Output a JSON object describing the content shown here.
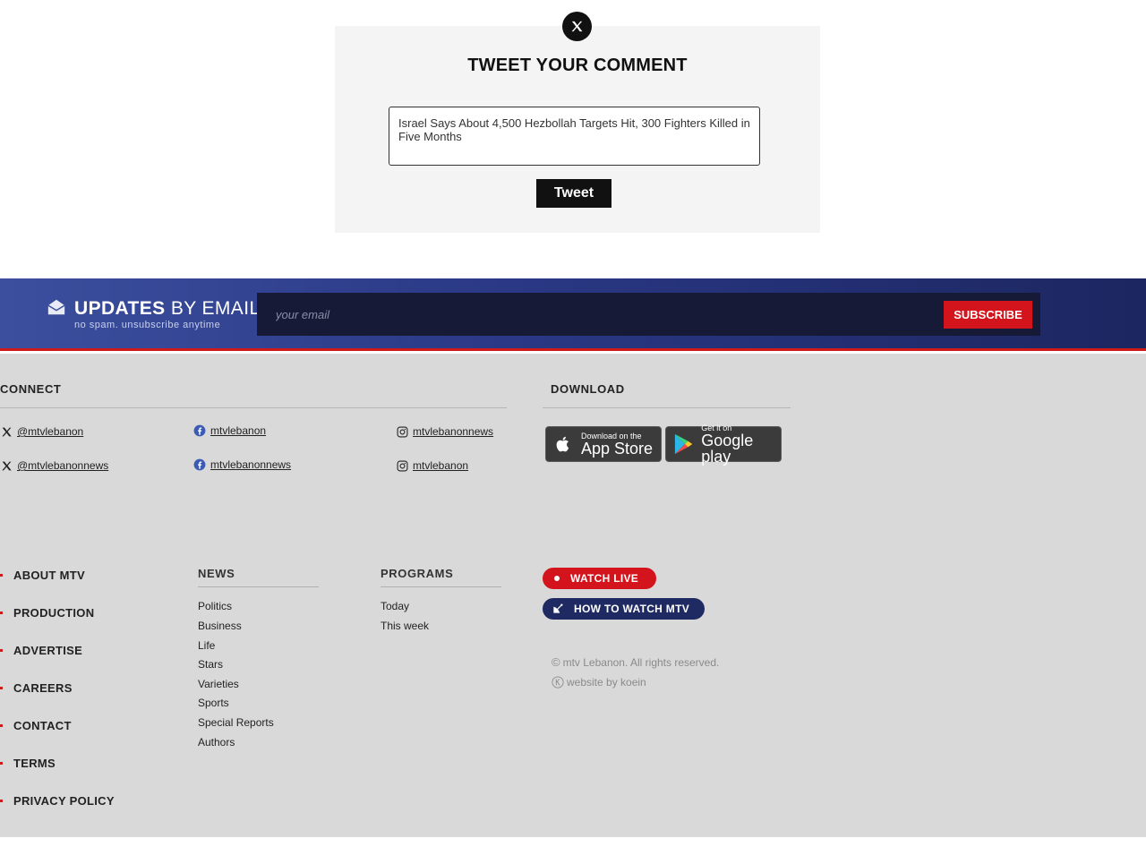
{
  "tweet": {
    "title": "TWEET YOUR COMMENT",
    "text": "Israel Says About 4,500 Hezbollah Targets Hit, 300 Fighters Killed in Five Months",
    "button": "Tweet"
  },
  "updates": {
    "title_bold": "UPDATES",
    "title_rest": "BY EMAIL",
    "subtitle": "no spam. unsubscribe anytime",
    "email_placeholder": "your email",
    "subscribe": "SUBSCRIBE"
  },
  "connect": {
    "heading": "CONNECT",
    "x": [
      "@mtvlebanon",
      "@mtvlebanonnews"
    ],
    "facebook": [
      "mtvlebanon",
      "mtvlebanonnews"
    ],
    "instagram": [
      "mtvlebanonnews",
      "mtvlebanon"
    ]
  },
  "download": {
    "heading": "DOWNLOAD",
    "appstore_small": "Download on the",
    "appstore_big": "App Store",
    "googleplay_small": "Get it on",
    "googleplay_big": "Google play"
  },
  "left_nav": [
    "ABOUT MTV",
    "PRODUCTION",
    "ADVERTISE",
    "CAREERS",
    "CONTACT",
    "TERMS",
    "PRIVACY POLICY"
  ],
  "news": {
    "heading": "NEWS",
    "links": [
      "Politics",
      "Business",
      "Life",
      "Stars",
      "Varieties",
      "Sports",
      "Special Reports",
      "Authors"
    ]
  },
  "programs": {
    "heading": "PROGRAMS",
    "links": [
      "Today",
      "This week"
    ]
  },
  "actions": {
    "watch_live": "WATCH LIVE",
    "how_to_watch": "HOW TO WATCH MTV"
  },
  "copyright": {
    "line1": "mtv Lebanon. All rights reserved.",
    "line2": "website by koein"
  },
  "colors": {
    "accent_red": "#d4141c",
    "navy": "#1f2a63",
    "footer_bg": "#d9d9d9"
  }
}
